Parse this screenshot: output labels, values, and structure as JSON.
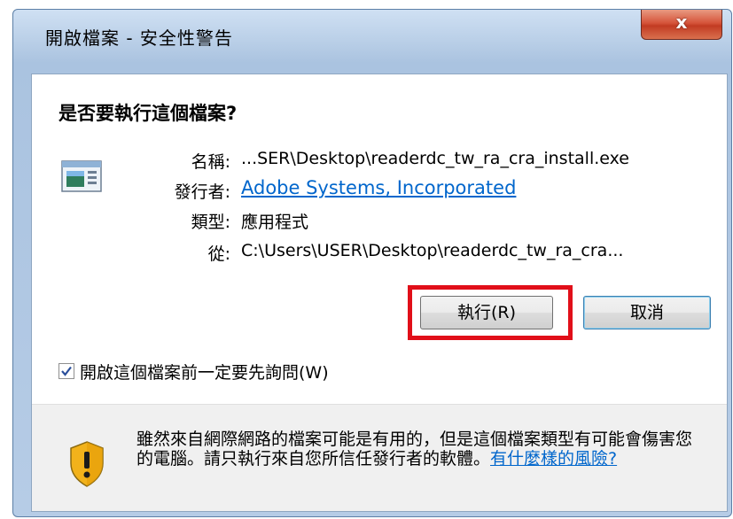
{
  "window": {
    "title": "開啟檔案 - 安全性警告",
    "close_label": "x"
  },
  "dialog": {
    "question": "是否要執行這個檔案?",
    "fields": {
      "name_label": "名稱:",
      "name_value": "...SER\\Desktop\\readerdc_tw_ra_cra_install.exe",
      "publisher_label": "發行者:",
      "publisher_value": "Adobe Systems, Incorporated",
      "type_label": "類型:",
      "type_value": "應用程式",
      "from_label": "從:",
      "from_value": "C:\\Users\\USER\\Desktop\\readerdc_tw_ra_cra..."
    },
    "buttons": {
      "run": "執行(R)",
      "cancel": "取消"
    },
    "checkbox": {
      "label": "開啟這個檔案前一定要先詢問(W)",
      "checked": true
    },
    "warning": {
      "text": "雖然來自網際網路的檔案可能是有用的，但是這個檔案類型有可能會傷害您的電腦。請只執行來自您所信任發行者的軟體。",
      "link": "有什麼樣的風險?"
    }
  },
  "colors": {
    "highlight": "#e10f19",
    "link": "#0066cc"
  }
}
